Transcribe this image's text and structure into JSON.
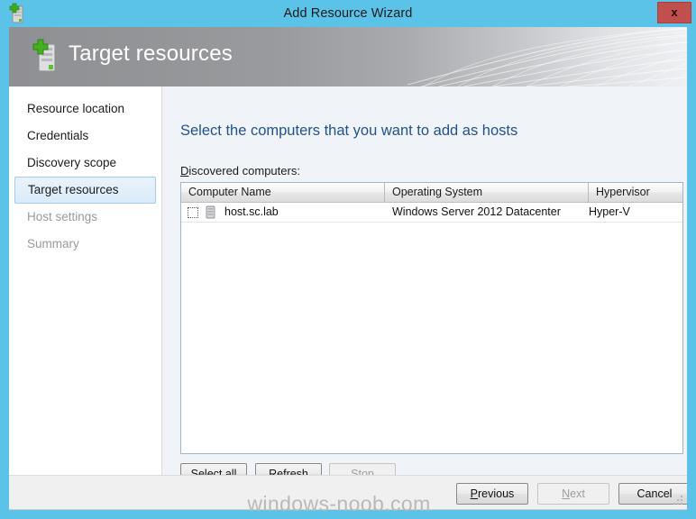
{
  "titlebar": {
    "title": "Add Resource Wizard",
    "icon": "add-server-icon",
    "close_label": "x"
  },
  "banner": {
    "title": "Target resources",
    "icon": "add-server-icon"
  },
  "sidebar": {
    "items": [
      {
        "label": "Resource location",
        "state": "normal"
      },
      {
        "label": "Credentials",
        "state": "normal"
      },
      {
        "label": "Discovery scope",
        "state": "normal"
      },
      {
        "label": "Target resources",
        "state": "selected"
      },
      {
        "label": "Host settings",
        "state": "disabled"
      },
      {
        "label": "Summary",
        "state": "disabled"
      }
    ]
  },
  "main": {
    "heading": "Select the computers that you want to add as hosts",
    "list_label_accel": "D",
    "list_label_rest": "iscovered computers:",
    "table": {
      "columns": [
        "Computer Name",
        "Operating System",
        "Hypervisor"
      ],
      "rows": [
        {
          "checked": false,
          "icon": "server-icon",
          "name": "host.sc.lab",
          "os": "Windows Server 2012 Datacenter",
          "hypervisor": "Hyper-V"
        }
      ]
    },
    "buttons": {
      "select_all": {
        "accel": "Select ",
        "accel_key": "a",
        "rest": "ll",
        "enabled": true
      },
      "refresh": {
        "accel": "",
        "accel_key": "R",
        "rest": "efresh",
        "enabled": true
      },
      "stop": {
        "accel": "",
        "accel_key": "S",
        "rest": "top",
        "enabled": false
      }
    }
  },
  "footer": {
    "previous": {
      "accel_key": "P",
      "rest": "revious",
      "enabled": true
    },
    "next": {
      "accel_key": "N",
      "rest": "ext",
      "enabled": false
    },
    "cancel": {
      "label": "Cancel",
      "enabled": true
    }
  },
  "watermark": {
    "text": "windows-noob.com"
  },
  "colors": {
    "titlebar": "#5bc3e8",
    "close_button": "#c0504d",
    "heading_text": "#21528c",
    "main_background": "#f0f4f8",
    "selection": "#d9ebf9",
    "accent_green": "#4cbb17"
  }
}
